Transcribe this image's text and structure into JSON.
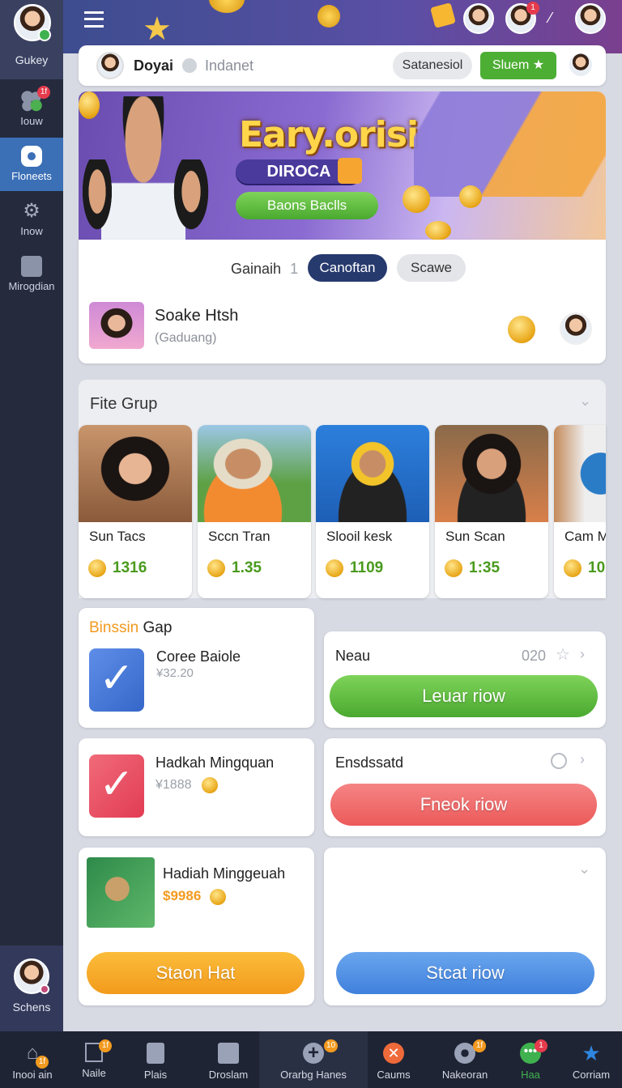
{
  "sidebar": {
    "profile_label": "Gukey",
    "items": [
      {
        "label": "Iouw",
        "badge": "1f"
      },
      {
        "label": "Floneets"
      },
      {
        "label": "Inow"
      },
      {
        "label": "Mirogdian"
      }
    ],
    "bottom_label": "Schens"
  },
  "topbar": {
    "menu_icon": "hamburger-icon",
    "notify_badge": "1"
  },
  "header": {
    "name": "Doyai",
    "subtitle": "Indanet",
    "button_secondary": "Satanesiol",
    "button_primary": "Sluem"
  },
  "banner": {
    "title": "Eary.orisi",
    "subtitle": "DIROCA",
    "button": "Baons Baclls"
  },
  "filter": {
    "label": "Gainaih",
    "count": "1",
    "tab_active": "Canoftan",
    "tab_other": "Scawe"
  },
  "profile_row": {
    "name": "Soake Htsh",
    "status": "(Gaduang)"
  },
  "group": {
    "title": "Fite Grup",
    "members": [
      {
        "name": "Sun Tacs",
        "amount": "1316"
      },
      {
        "name": "Sccn Tran",
        "amount": "1.35"
      },
      {
        "name": "Slooil kesk",
        "amount": "1109"
      },
      {
        "name": "Sun Scan",
        "amount": "1:35"
      },
      {
        "name": "Cam M",
        "amount": "10"
      }
    ]
  },
  "cards": {
    "bonus": {
      "title_highlight": "Binssin",
      "title_rest": " Gap",
      "item_title": "Coree Baiole",
      "item_amount": "¥32.20"
    },
    "neau": {
      "title": "Neau",
      "value": "020",
      "button": "Leuar riow"
    },
    "hadkah": {
      "title": "Hadkah Mingquan",
      "amount": "¥1888"
    },
    "ensdssatd": {
      "title": "Ensdssatd",
      "button": "Fneok riow"
    },
    "hadiah": {
      "title": "Hadiah Minggeuah",
      "amount": "$9986",
      "button": "Staon Hat"
    },
    "empty": {
      "button": "Stcat riow"
    }
  },
  "bottom_nav": [
    {
      "label": "Inooi ain",
      "badge": "1f"
    },
    {
      "label": "Naile",
      "badge": "1f"
    },
    {
      "label": "Plais"
    },
    {
      "label": "Droslam"
    },
    {
      "label": "Orarbg Hanes",
      "badge": "10"
    },
    {
      "label": "Caums"
    },
    {
      "label": "Nakeoran",
      "badge": "1f"
    },
    {
      "label": "Haa",
      "badge": "1"
    },
    {
      "label": "Corriam"
    }
  ],
  "colors": {
    "accent_green": "#58b93a",
    "accent_navy": "#263a6e",
    "orange": "#f5a623",
    "red": "#ef5f5f",
    "blue": "#4a8ee0"
  }
}
